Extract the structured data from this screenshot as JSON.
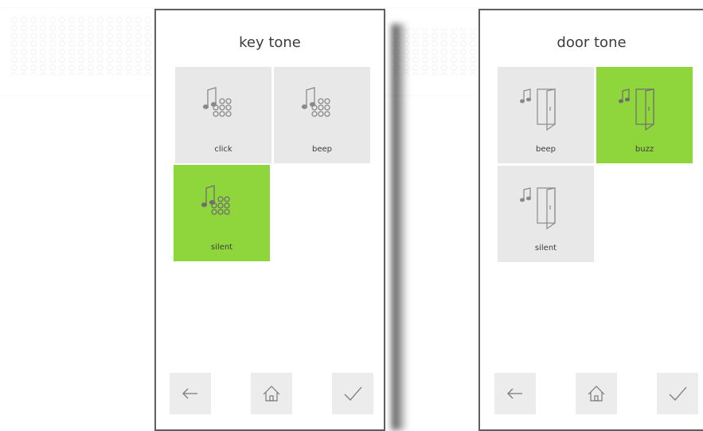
{
  "left_screen": {
    "title": "key tone",
    "options": [
      {
        "label": "click",
        "selected": false,
        "icon": "keypad-music-icon"
      },
      {
        "label": "beep",
        "selected": false,
        "icon": "keypad-music-icon"
      },
      {
        "label": "silent",
        "selected": true,
        "icon": "keypad-music-icon"
      }
    ]
  },
  "right_screen": {
    "title": "door tone",
    "options": [
      {
        "label": "beep",
        "selected": false,
        "icon": "door-music-icon"
      },
      {
        "label": "buzz",
        "selected": true,
        "icon": "door-music-icon"
      },
      {
        "label": "silent",
        "selected": false,
        "icon": "door-music-icon"
      }
    ]
  },
  "nav": {
    "back_icon": "arrow-left-icon",
    "home_icon": "home-icon",
    "confirm_icon": "checkmark-icon"
  },
  "colors": {
    "selected": "#8fd63c",
    "tile": "#e8e8e8",
    "frame": "#5f5f5f",
    "icon": "#8a8a8a"
  }
}
